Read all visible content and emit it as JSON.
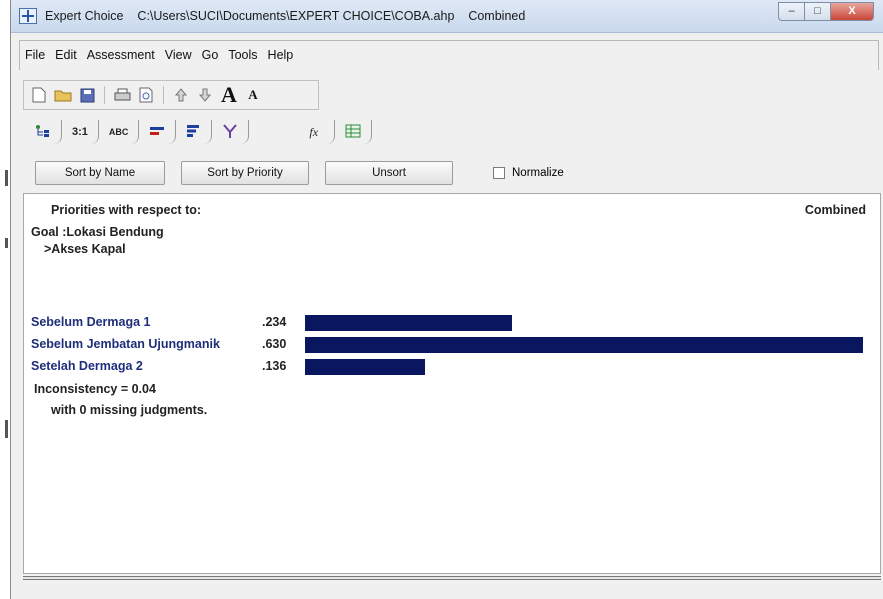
{
  "window": {
    "app_name": "Expert Choice",
    "file_path": "C:\\Users\\SUCI\\Documents\\EXPERT CHOICE\\COBA.ahp",
    "mode": "Combined",
    "controls": {
      "minimize": "–",
      "maximize": "□",
      "close": "X"
    }
  },
  "menu": {
    "items": [
      "File",
      "Edit",
      "Assessment",
      "View",
      "Go",
      "Tools",
      "Help"
    ]
  },
  "toolbar": {
    "icons": [
      "new-file-icon",
      "open-folder-icon",
      "save-icon",
      "print-icon",
      "print-preview-icon",
      "move-up-icon",
      "move-down-icon",
      "font-larger-icon",
      "font-smaller-icon"
    ],
    "big_a": "A",
    "small_a": "A"
  },
  "tabs": {
    "items": [
      {
        "label": "",
        "icon": "tree-view-icon"
      },
      {
        "label": "3:1",
        "icon": "numerical-comparison-icon"
      },
      {
        "label": "ABC",
        "icon": "verbal-comparison-icon"
      },
      {
        "label": "",
        "icon": "graphical-comparison-icon"
      },
      {
        "label": "",
        "icon": "priorities-icon"
      },
      {
        "label": "",
        "icon": "synthesis-icon"
      },
      {
        "label": "fx",
        "icon": "formula-icon"
      },
      {
        "label": "",
        "icon": "data-grid-icon"
      }
    ]
  },
  "actions": {
    "sort_by_name": "Sort by Name",
    "sort_by_priority": "Sort by Priority",
    "unsort": "Unsort",
    "normalize": "Normalize",
    "normalize_checked": false
  },
  "results": {
    "heading": "Priorities with respect to:",
    "mode_label": "Combined",
    "goal": "Goal :Lokasi Bendung",
    "node": ">Akses Kapal",
    "alternatives": [
      {
        "name": "Sebelum Dermaga 1",
        "value_label": ".234",
        "value": 0.234
      },
      {
        "name": "Sebelum Jembatan Ujungmanik",
        "value_label": ".630",
        "value": 0.63
      },
      {
        "name": "Setelah Dermaga 2",
        "value_label": ".136",
        "value": 0.136
      }
    ],
    "bar_color": "#0a1660",
    "inconsistency": "Inconsistency = 0.04",
    "missing": "with 0  missing judgments."
  }
}
